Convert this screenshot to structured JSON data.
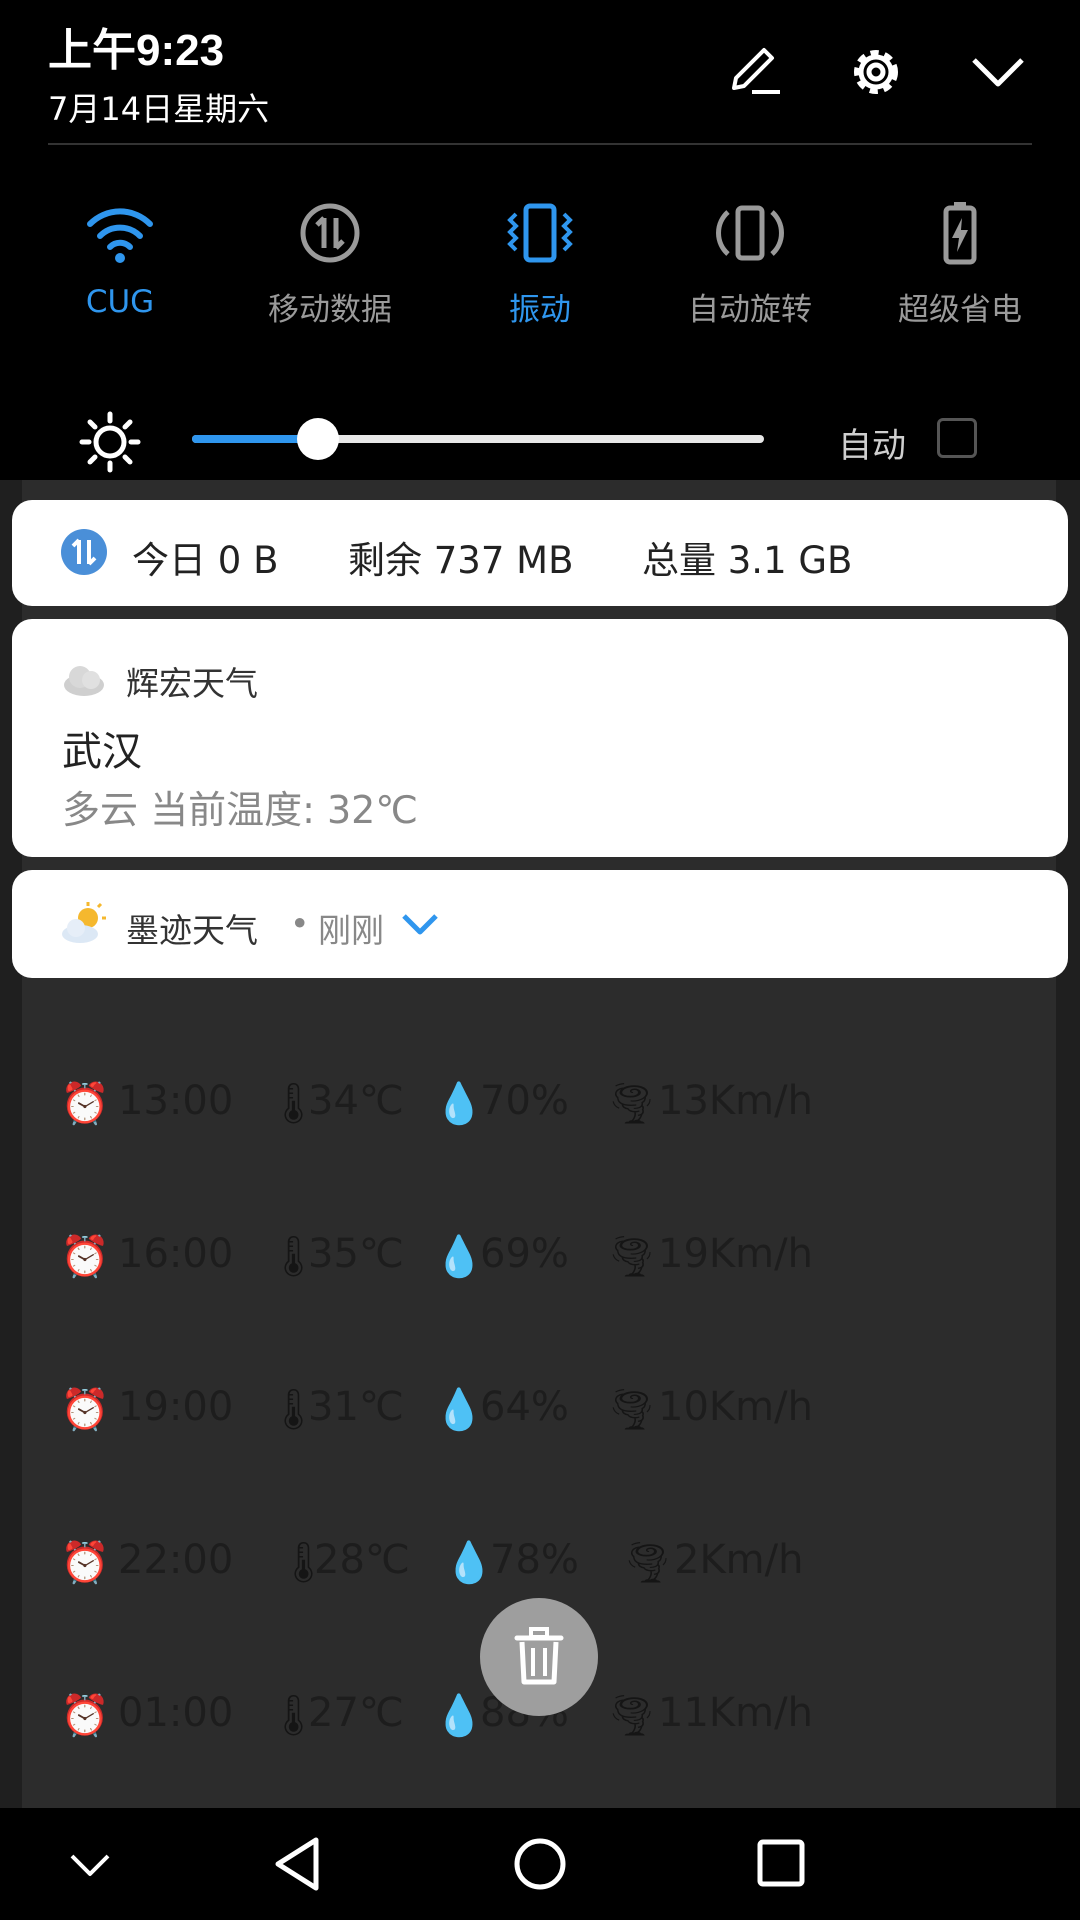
{
  "status_header": {
    "time": "上午9:23",
    "date": "7月14日星期六",
    "icons": [
      "edit-icon",
      "settings-icon",
      "collapse-icon"
    ]
  },
  "quick_toggles": [
    {
      "label": "CUG",
      "icon": "wifi-icon",
      "active": true
    },
    {
      "label": "移动数据",
      "icon": "mobile-data-icon",
      "active": false
    },
    {
      "label": "振动",
      "icon": "vibrate-icon",
      "active": true
    },
    {
      "label": "自动旋转",
      "icon": "auto-rotate-icon",
      "active": false
    },
    {
      "label": "超级省电",
      "icon": "battery-saver-icon",
      "active": false
    }
  ],
  "brightness": {
    "icon": "brightness-icon",
    "level": 0.22,
    "auto_label": "自动",
    "auto_checked": false
  },
  "data_usage": {
    "today": "今日 0 B",
    "remaining": "剩余 737 MB",
    "total": "总量 3.1 GB"
  },
  "weather_notification_1": {
    "app_name": "辉宏天气",
    "city": "武汉",
    "condition": "多云 当前温度: 32℃"
  },
  "weather_notification_2": {
    "app_name": "墨迹天气",
    "separator": "•",
    "time_ago": "刚刚"
  },
  "background_forecast": [
    {
      "time": "13:00",
      "temp": "34℃",
      "humidity": "70%",
      "wind": "13Km/h"
    },
    {
      "time": "16:00",
      "temp": "35℃",
      "humidity": "69%",
      "wind": "19Km/h"
    },
    {
      "time": "19:00",
      "temp": "31℃",
      "humidity": "64%",
      "wind": "10Km/h"
    },
    {
      "time": "22:00",
      "temp": "28℃",
      "humidity": "78%",
      "wind": "2Km/h"
    },
    {
      "time": "01:00",
      "temp": "27℃",
      "humidity": "88%",
      "wind": "11Km/h"
    }
  ],
  "colors": {
    "accent": "#2f96ee",
    "inactive": "#9a9a9a",
    "panel_bg": "#000000",
    "card_bg": "#ffffff"
  },
  "nav_icons": [
    "nav-hide-icon",
    "back-icon",
    "home-icon",
    "recents-icon"
  ],
  "fab_icon": "trash-icon"
}
